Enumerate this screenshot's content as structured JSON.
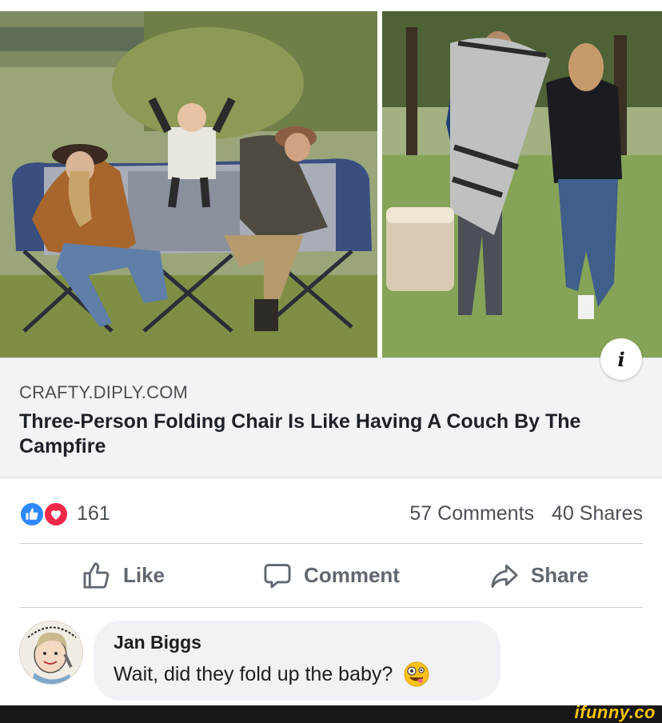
{
  "post": {
    "link_preview": {
      "domain": "CRAFTY.DIPLY.COM",
      "title": "Three-Person Folding Chair Is Like Having A Couch By The Campfire"
    },
    "info_icon": "info-icon"
  },
  "stats": {
    "reaction_count": "161",
    "comments": "57 Comments",
    "shares": "40 Shares",
    "reactions": [
      "like",
      "love"
    ]
  },
  "actions": {
    "like": "Like",
    "comment": "Comment",
    "share": "Share"
  },
  "comment": {
    "author": "Jan Biggs",
    "text": "Wait, did they fold up the baby?",
    "emoji": "zany-face-emoji"
  },
  "watermark": "ifunny.co",
  "colors": {
    "like_blue": "#2d88ff",
    "love_red": "#f0284a",
    "preview_bg": "#f2f3f5",
    "bubble_bg": "#f0f2f5",
    "watermark_yellow": "#f5c400"
  }
}
